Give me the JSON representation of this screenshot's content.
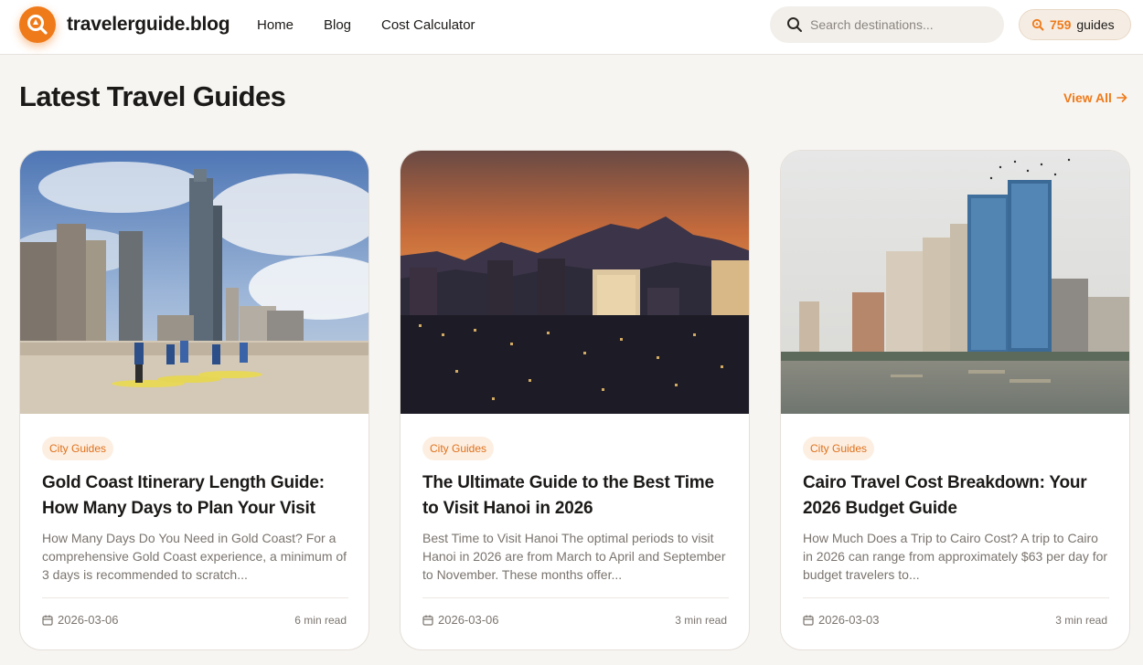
{
  "header": {
    "site_name": "travelerguide.blog",
    "nav": [
      "Home",
      "Blog",
      "Cost Calculator"
    ],
    "search_placeholder": "Search destinations...",
    "guides_count": "759",
    "guides_label": "guides",
    "accent_color": "#ef7a1a"
  },
  "section": {
    "title": "Latest Travel Guides",
    "view_all": "View All"
  },
  "cards": [
    {
      "image": "gold-coast-beach-skyline-photo",
      "tag": "City Guides",
      "title": "Gold Coast Itinerary Length Guide: How Many Days to Plan Your Visit",
      "excerpt": "How Many Days Do You Need in Gold Coast? For a comprehensive Gold Coast experience, a minimum of 3 days is recommended to scratch...",
      "date": "2026-03-06",
      "read_time": "6 min read"
    },
    {
      "image": "hanoi-city-sunset-photo",
      "tag": "City Guides",
      "title": "The Ultimate Guide to the Best Time to Visit Hanoi in 2026",
      "excerpt": "Best Time to Visit Hanoi The optimal periods to visit Hanoi in 2026 are from March to April and September to November. These months offer...",
      "date": "2026-03-06",
      "read_time": "3 min read"
    },
    {
      "image": "cairo-nile-skyline-photo",
      "tag": "City Guides",
      "title": "Cairo Travel Cost Breakdown: Your 2026 Budget Guide",
      "excerpt": "How Much Does a Trip to Cairo Cost? A trip to Cairo in 2026 can range from approximately $63 per day for budget travelers to...",
      "date": "2026-03-03",
      "read_time": "3 min read"
    }
  ]
}
